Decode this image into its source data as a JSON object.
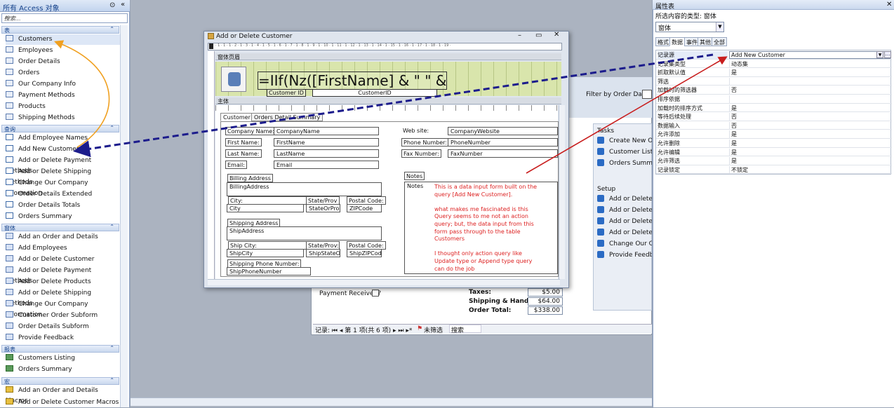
{
  "nav": {
    "title": "所有 Access 对象",
    "search_placeholder": "搜索...",
    "groups": [
      {
        "label": "表",
        "items": [
          "Customers",
          "Employees",
          "Order Details",
          "Orders",
          "Our Company Info",
          "Payment Methods",
          "Products",
          "Shipping Methods"
        ]
      },
      {
        "label": "查询",
        "items": [
          "Add Employee Names",
          "Add New Customer",
          "Add or Delete Payment Methods",
          "Add or Delete Shipping Methods",
          "Change Our Company Information",
          "Order Details Extended",
          "Order Details Totals",
          "Orders Summary"
        ]
      },
      {
        "label": "窗体",
        "items": [
          "Add an Order and Details",
          "Add Employees",
          "Add or Delete Customer",
          "Add or Delete Payment Methods",
          "Add or Delete Products",
          "Add or Delete Shipping Methods",
          "Change Our Company Information",
          "Customer Order Subform",
          "Order Details Subform",
          "Provide Feedback"
        ]
      },
      {
        "label": "报表",
        "items": [
          "Customers Listing",
          "Orders Summary"
        ]
      },
      {
        "label": "宏",
        "items": [
          "Add an Order and Details Macros",
          "Add or Delete Customer Macros"
        ]
      }
    ]
  },
  "background_form": {
    "filter_label": "Filter by Order Date:",
    "tasks_label": "Tasks",
    "tasks": [
      "Create New Ord",
      "Customer Listing",
      "Orders Summary"
    ],
    "setup_label": "Setup",
    "setup": [
      "Add or Delete C",
      "Add or Delete P",
      "Add or Delete P",
      "Add or Delete S",
      "Change Our Con",
      "Provide Feedback"
    ],
    "payment_label": "Payment Received?",
    "taxes_label": "Taxes:",
    "taxes_value": "$5.00",
    "shipping_label": "Shipping & Handling:",
    "shipping_value": "$64.00",
    "total_label": "Order Total:",
    "total_value": "$338.00",
    "record_label": "记录: ⏮ ◂ 第 1 项(共 6 项) ▸ ⏭ ▸* ",
    "nofilter_label": "未筛选",
    "search_label": "搜索"
  },
  "dialog": {
    "title": "Add or Delete Customer",
    "ruler_text": "· 1 · 1 · 1 · 2 · 1 · 3 · 1 · 4 · 1 · 5 · 1 · 6 · 1 · 7 · 1 · 8 · 1 · 9 · 1 · 10 · 1 · 11 · 1 · 12 · 1 · 13 · 1 · 14 · 1 · 15 · 1 · 16 · 1 · 17 · 1 · 18 · 1 · 19 ·",
    "header_section": "窗体页眉",
    "detail_section": "主体",
    "formula": "=IIf(Nz([FirstName] & \" \" & [La",
    "customer_id_label": "Customer ID",
    "customer_id_field": "CustomerID",
    "tabs": [
      "Customer",
      "Orders Detail Summary"
    ],
    "fields": {
      "company_label": "Company Name:",
      "company": "CompanyName",
      "first_label": "First Name:",
      "first": "FirstName",
      "last_label": "Last Name:",
      "last": "LastName",
      "email_label": "Email:",
      "email": "Email",
      "web_label": "Web site:",
      "web": "CompanyWebsite",
      "phone_label": "Phone Number:",
      "phone": "PhoneNumber",
      "fax_label": "Fax Number:",
      "fax": "FaxNumber",
      "billing_label": "Billing Address",
      "billing": "BillingAddress",
      "city_label": "City:",
      "city": "City",
      "state_label": "State/Prov",
      "state": "StateOrProv",
      "postal_label": "Postal Code:",
      "postal": "ZIPCode",
      "shipping_label": "Shipping Address",
      "shipping": "ShipAddress",
      "shipcity_label": "Ship City:",
      "shipcity": "ShipCity",
      "shipstate_label": "State/Prov:",
      "shipstate": "ShipStateOr",
      "shippostal_label": "Postal Code:",
      "shippostal": "ShipZIPCode",
      "shipphone_label": "Shipping Phone Number:",
      "shipphone": "ShipPhoneNumber",
      "notes_label": "Notes",
      "notes": "Notes"
    },
    "notes_annotation": "This is a data input form built on the query [Add New Customer].\n\nwhat makes me fascinated is this Query seems to me not an action query; but, the data input from this form pass through to the table Customers\n\nI thought only action query like Update type or Append type query can do the job"
  },
  "props": {
    "title": "属性表",
    "selection_type": "所选内容的类型: 窗体",
    "combo_value": "窗体",
    "tabs": [
      "格式",
      "数据",
      "事件",
      "其他",
      "全部"
    ],
    "rows": [
      {
        "k": "记录源",
        "v": "Add New Customer"
      },
      {
        "k": "记录集类型",
        "v": "动态集"
      },
      {
        "k": "抓取默认值",
        "v": "是"
      },
      {
        "k": "筛选",
        "v": ""
      },
      {
        "k": "加载时的筛选器",
        "v": "否"
      },
      {
        "k": "排序依据",
        "v": ""
      },
      {
        "k": "加载时的排序方式",
        "v": "是"
      },
      {
        "k": "等待后续处理",
        "v": "否"
      },
      {
        "k": "数据输入",
        "v": "否"
      },
      {
        "k": "允许添加",
        "v": "是"
      },
      {
        "k": "允许删除",
        "v": "是"
      },
      {
        "k": "允许编辑",
        "v": "是"
      },
      {
        "k": "允许筛选",
        "v": "是"
      },
      {
        "k": "记录锁定",
        "v": "不锁定"
      }
    ]
  },
  "colors": {
    "annotation_blue": "#1c1c8c",
    "annotation_orange": "#f0a020",
    "annotation_red": "#c81e1e",
    "notes_text": "#dd2222"
  }
}
